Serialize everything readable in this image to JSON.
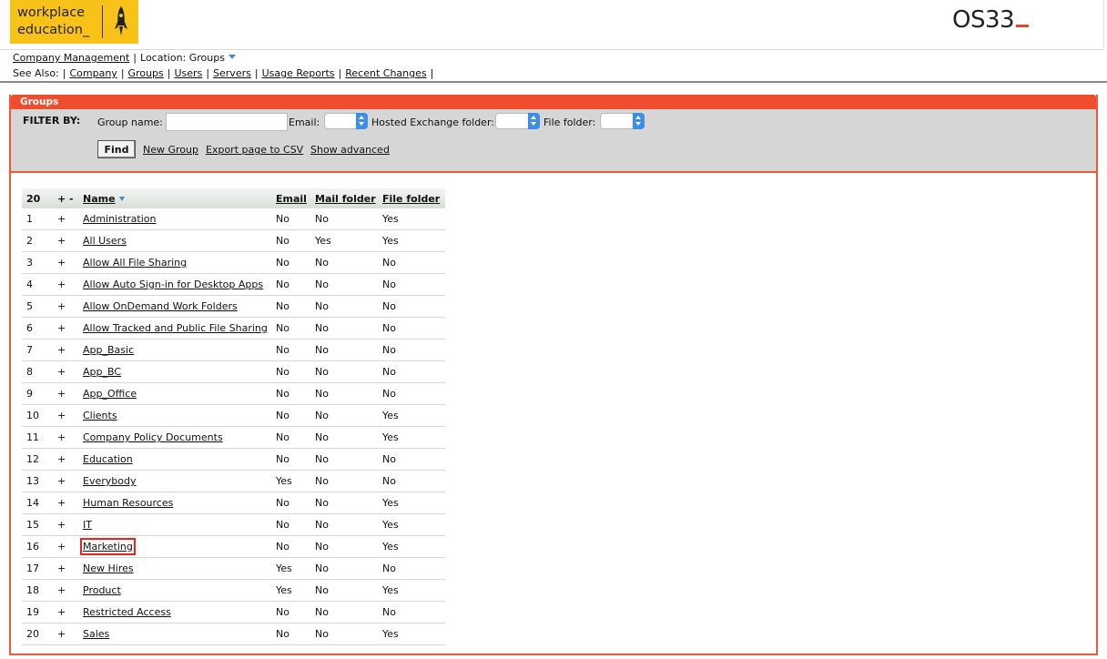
{
  "header": {
    "logo_line1": "workplace",
    "logo_line2": "education_",
    "brand": "OS33"
  },
  "nav": {
    "company_management": "Company Management",
    "location_label": "Location:",
    "location_value": "Groups",
    "see_also_label": "See Also:",
    "links": [
      "Company",
      "Groups",
      "Users",
      "Servers",
      "Usage Reports",
      "Recent Changes"
    ]
  },
  "panel": {
    "title": "Groups",
    "filter": {
      "label": "FILTER BY:",
      "group_name_label": "Group name:",
      "group_name_value": "",
      "email_label": "Email:",
      "hosted_exchange_label": "Hosted Exchange folder:",
      "file_folder_label": "File folder:",
      "find_label": "Find",
      "new_group_label": "New Group",
      "export_label": "Export page to CSV",
      "show_advanced_label": "Show advanced"
    }
  },
  "table": {
    "count": "20",
    "plus_minus": "+ -",
    "headers": {
      "name": "Name",
      "email": "Email",
      "mail_folder": "Mail folder",
      "file_folder": "File folder"
    },
    "rows": [
      {
        "num": "1",
        "plus": "+",
        "name": "Administration",
        "email": "No",
        "mail": "No",
        "file": "Yes"
      },
      {
        "num": "2",
        "plus": "+",
        "name": "All Users",
        "email": "No",
        "mail": "Yes",
        "file": "Yes"
      },
      {
        "num": "3",
        "plus": "+",
        "name": "Allow All File Sharing",
        "email": "No",
        "mail": "No",
        "file": "No"
      },
      {
        "num": "4",
        "plus": "+",
        "name": "Allow Auto Sign-in for Desktop Apps",
        "email": "No",
        "mail": "No",
        "file": "No"
      },
      {
        "num": "5",
        "plus": "+",
        "name": "Allow OnDemand Work Folders",
        "email": "No",
        "mail": "No",
        "file": "No"
      },
      {
        "num": "6",
        "plus": "+",
        "name": "Allow Tracked and Public File Sharing",
        "email": "No",
        "mail": "No",
        "file": "No"
      },
      {
        "num": "7",
        "plus": "+",
        "name": "App_Basic",
        "email": "No",
        "mail": "No",
        "file": "No"
      },
      {
        "num": "8",
        "plus": "+",
        "name": "App_BC",
        "email": "No",
        "mail": "No",
        "file": "No"
      },
      {
        "num": "9",
        "plus": "+",
        "name": "App_Office",
        "email": "No",
        "mail": "No",
        "file": "No"
      },
      {
        "num": "10",
        "plus": "+",
        "name": "Clients",
        "email": "No",
        "mail": "No",
        "file": "Yes"
      },
      {
        "num": "11",
        "plus": "+",
        "name": "Company Policy Documents",
        "email": "No",
        "mail": "No",
        "file": "Yes"
      },
      {
        "num": "12",
        "plus": "+",
        "name": "Education",
        "email": "No",
        "mail": "No",
        "file": "No"
      },
      {
        "num": "13",
        "plus": "+",
        "name": "Everybody",
        "email": "Yes",
        "mail": "No",
        "file": "No"
      },
      {
        "num": "14",
        "plus": "+",
        "name": "Human Resources",
        "email": "No",
        "mail": "No",
        "file": "Yes"
      },
      {
        "num": "15",
        "plus": "+",
        "name": "IT",
        "email": "No",
        "mail": "No",
        "file": "Yes"
      },
      {
        "num": "16",
        "plus": "+",
        "name": "Marketing",
        "email": "No",
        "mail": "No",
        "file": "Yes"
      },
      {
        "num": "17",
        "plus": "+",
        "name": "New Hires",
        "email": "Yes",
        "mail": "No",
        "file": "No"
      },
      {
        "num": "18",
        "plus": "+",
        "name": "Product",
        "email": "Yes",
        "mail": "No",
        "file": "Yes"
      },
      {
        "num": "19",
        "plus": "+",
        "name": "Restricted Access",
        "email": "No",
        "mail": "No",
        "file": "No"
      },
      {
        "num": "20",
        "plus": "+",
        "name": "Sales",
        "email": "No",
        "mail": "No",
        "file": "Yes"
      }
    ]
  },
  "colors": {
    "accent": "#ee4e2d",
    "logo_bg": "#f8c218",
    "highlight": "#e8231b"
  },
  "highlighted_row": "Marketing"
}
